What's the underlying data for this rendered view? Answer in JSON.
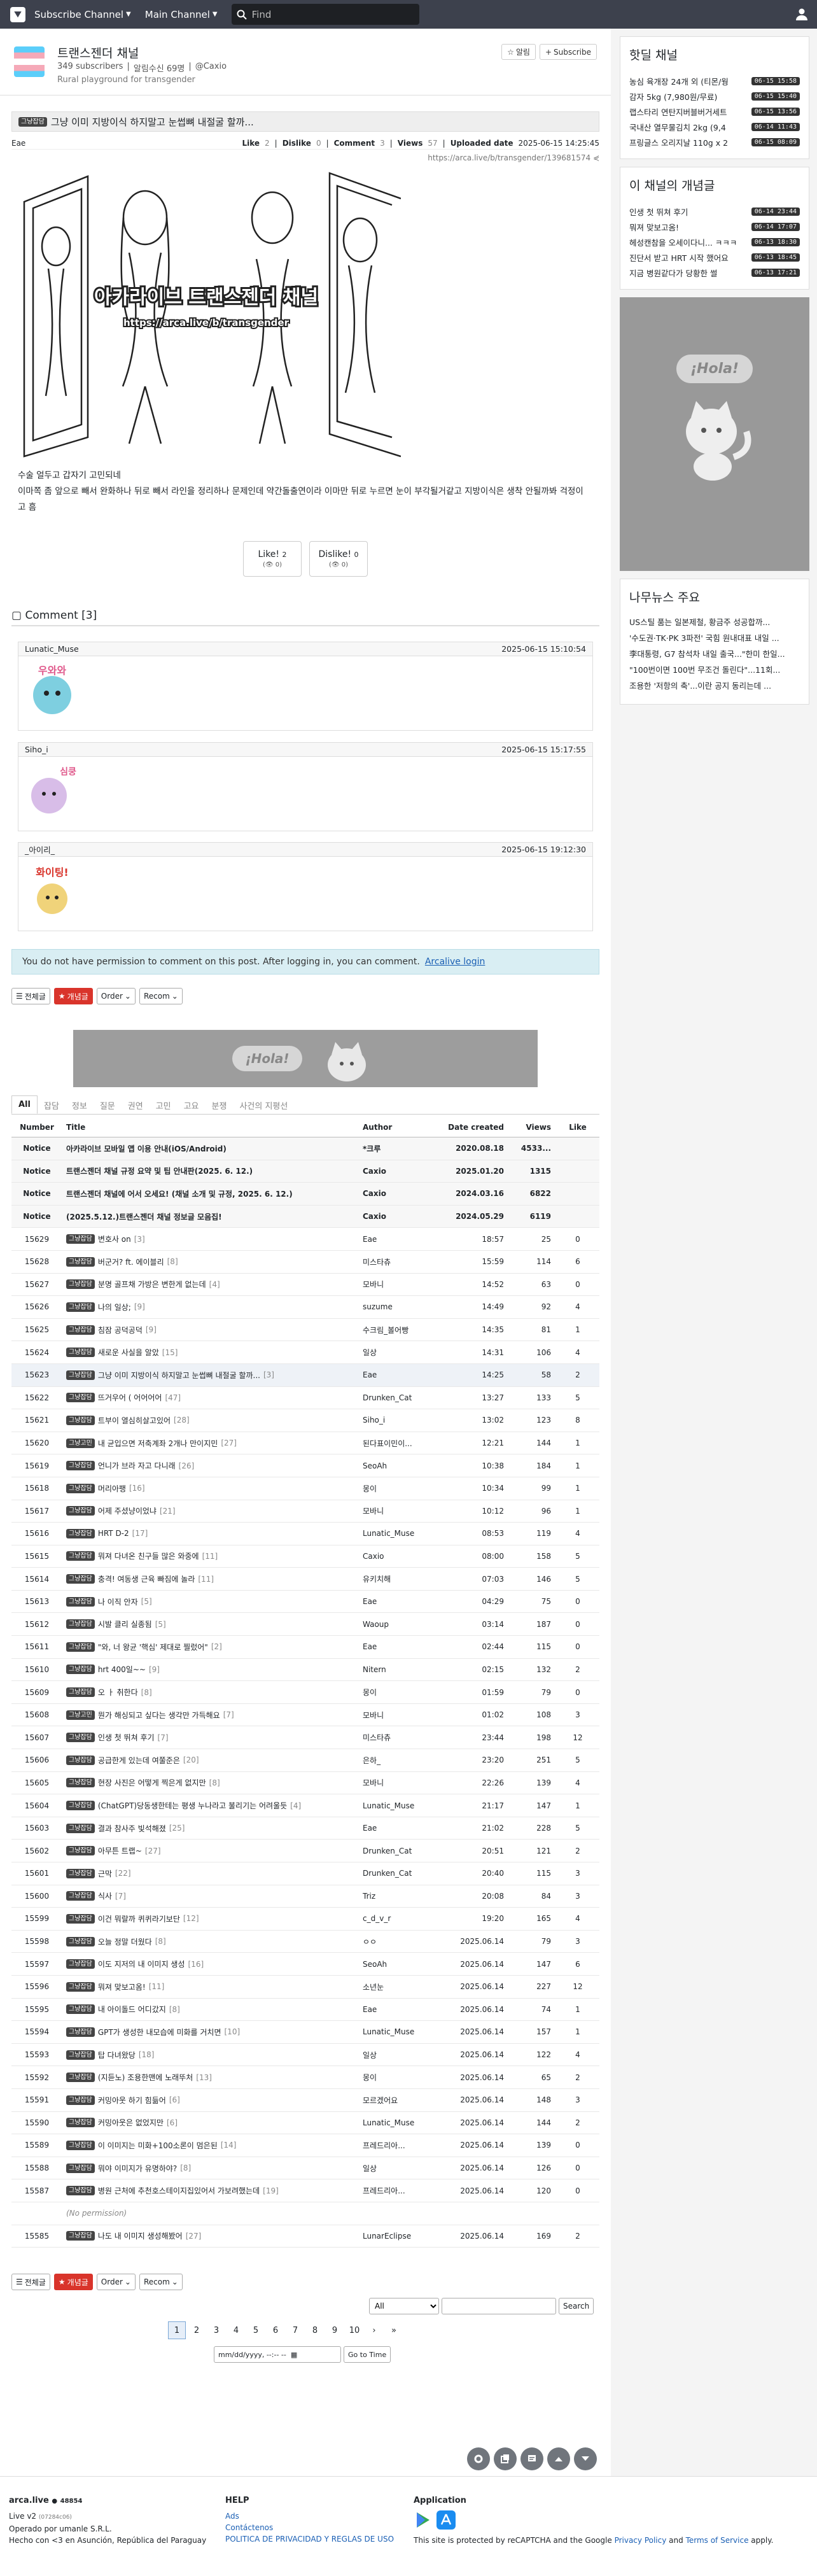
{
  "nav": {
    "subscribe_channel": "Subscribe Channel",
    "main_channel": "Main Channel",
    "search_placeholder": "Find"
  },
  "channel": {
    "title": "트랜스젠더 채널",
    "subscribers": "349 subscribers",
    "alarm": "알림수신 69명",
    "owner": "@Caxio",
    "description": "Rural playground for transgender",
    "alarm_button": "알림",
    "subscribe_button": "Subscribe"
  },
  "article": {
    "category": "그냥잡담",
    "title": "그냥 이미 지방이식 하지말고 눈썹뼈 내절굴 할까...",
    "author": "Eae",
    "like_label": "Like",
    "like_count": "2",
    "dislike_label": "Dislike",
    "dislike_count": "0",
    "comment_label": "Comment",
    "comment_count": "3",
    "views_label": "Views",
    "views_count": "57",
    "uploaded_label": "Uploaded date",
    "uploaded_date": "2025-06-15 14:25:45",
    "url": "https://arca.live/b/transgender/139681574",
    "image_text": "아카라이브 트랜스젠더 채널",
    "image_url_text": "https://arca.live/b/transgender",
    "body_line1": "수술 얼두고 갑자기 고민되네",
    "body_line2": "이마쪽 좀 앞으로 빼서 완화하나 뒤로 빼서 라인을 정리하나 문제인데 약간돌출연이라 이마만 뒤로 누르면 눈이 부각될거같고 지방이식은 생착 안될까봐 걱정이고 흠",
    "like_button": "Like!",
    "like_btn_count": "2",
    "like_sub": "0",
    "dislike_button": "Dislike!",
    "dislike_btn_count": "0",
    "dislike_sub": "0"
  },
  "comments": {
    "header": "Comment [3]",
    "items": [
      {
        "author": "Lunatic_Muse",
        "date": "2025-06-15 15:10:54",
        "sticker": "우와와"
      },
      {
        "author": "Siho_i",
        "date": "2025-06-15 15:17:55",
        "sticker": "심쿵"
      },
      {
        "author": "_아이리_",
        "date": "2025-06-15 19:12:30",
        "sticker": "화이팅!"
      }
    ]
  },
  "permission_notice": {
    "text": "You do not have permission to comment on this post. After logging in, you can comment.",
    "link": "Arcalive login"
  },
  "toolbar": {
    "all": "전체글",
    "best": "개념글",
    "order": "Order",
    "recom": "Recom"
  },
  "ad_text": "¡Hola!",
  "tabs": [
    "All",
    "잡담",
    "정보",
    "질문",
    "권연",
    "고민",
    "고요",
    "분쟁",
    "사건의 지평선"
  ],
  "table": {
    "headers": [
      "Number",
      "Title",
      "Author",
      "Date created",
      "Views",
      "Like"
    ],
    "notices": [
      {
        "num": "Notice",
        "title": "아카라이브 모바일 앱 이용 안내(iOS/Android)",
        "author": "*크루",
        "date": "2020.08.18",
        "views": "4533...",
        "like": ""
      },
      {
        "num": "Notice",
        "title": "트랜스젠더 채널 규정 요약 및 팁 안내판(2025. 6. 12.)",
        "author": "Caxio",
        "date": "2025.01.20",
        "views": "1315",
        "like": ""
      },
      {
        "num": "Notice",
        "title": "트랜스젠더 채널에 어서 오세요! (채널 소개 및 규정, 2025. 6. 12.)",
        "author": "Caxio",
        "date": "2024.03.16",
        "views": "6822",
        "like": ""
      },
      {
        "num": "Notice",
        "title": "(2025.5.12.)트랜스젠더 채널 정보글 모음집!",
        "author": "Caxio",
        "date": "2024.05.29",
        "views": "6119",
        "like": ""
      }
    ],
    "rows": [
      {
        "num": "15629",
        "cat": "그냥잡담",
        "title": "변호사 on",
        "cmt": "[3]",
        "author": "Eae",
        "date": "18:57",
        "views": "25",
        "like": "0"
      },
      {
        "num": "15628",
        "cat": "그냥잡담",
        "title": "버군거? ft. 에이블리",
        "cmt": "[8]",
        "author": "미스타츄",
        "date": "15:59",
        "views": "114",
        "like": "6"
      },
      {
        "num": "15627",
        "cat": "그냥잡담",
        "title": "분명 골프채 가방은 변한게 없는데",
        "cmt": "[4]",
        "author": "모바니",
        "date": "14:52",
        "views": "63",
        "like": "0"
      },
      {
        "num": "15626",
        "cat": "그냥잡담",
        "title": "나의 일상;",
        "cmt": "[9]",
        "author": "suzume",
        "date": "14:49",
        "views": "92",
        "like": "4"
      },
      {
        "num": "15625",
        "cat": "그냥잡담",
        "title": "침잠 공덕공덕",
        "cmt": "[9]",
        "author": "수크림_볼어빵",
        "date": "14:35",
        "views": "81",
        "like": "1"
      },
      {
        "num": "15624",
        "cat": "그냥잡담",
        "title": "새로운 사실을 알았",
        "cmt": "[15]",
        "author": "일상",
        "date": "14:31",
        "views": "106",
        "like": "4"
      },
      {
        "num": "15623",
        "cat": "그냥잡담",
        "title": "그냥 이미 지방이식 하지말고 눈썹뼈 내절굴 할까...",
        "cmt": "[3]",
        "author": "Eae",
        "date": "14:25",
        "views": "58",
        "like": "2",
        "hl": true
      },
      {
        "num": "15622",
        "cat": "그냥잡담",
        "title": "뜨거우어 ( 어어어어",
        "cmt": "[47]",
        "author": "Drunken_Cat",
        "date": "13:27",
        "views": "133",
        "like": "5"
      },
      {
        "num": "15621",
        "cat": "그냥잡담",
        "title": "트부이 열심히살고있어",
        "cmt": "[28]",
        "author": "Siho_i",
        "date": "13:02",
        "views": "123",
        "like": "8"
      },
      {
        "num": "15620",
        "cat": "그냥고민",
        "title": "내 균입으면 저축계좌 2개나 만이지민",
        "cmt": "[27]",
        "author": "된다표이민이...",
        "date": "12:21",
        "views": "144",
        "like": "1"
      },
      {
        "num": "15619",
        "cat": "그냥잡담",
        "title": "언니가 브라 자고 다니래",
        "cmt": "[26]",
        "author": "SeoAh",
        "date": "10:38",
        "views": "184",
        "like": "1"
      },
      {
        "num": "15618",
        "cat": "그냥잡담",
        "title": "머리아팽",
        "cmt": "[16]",
        "author": "몽이",
        "date": "10:34",
        "views": "99",
        "like": "1"
      },
      {
        "num": "15617",
        "cat": "그냥잡담",
        "title": "어제 주셨냥이었냐",
        "cmt": "[21]",
        "author": "모바니",
        "date": "10:12",
        "views": "96",
        "like": "1"
      },
      {
        "num": "15616",
        "cat": "그냥잡담",
        "title": "HRT D-2",
        "cmt": "[17]",
        "author": "Lunatic_Muse",
        "date": "08:53",
        "views": "119",
        "like": "4"
      },
      {
        "num": "15615",
        "cat": "그냥잡담",
        "title": "뭐져 다녀온 친구들 많은 와중에",
        "cmt": "[11]",
        "author": "Caxio",
        "date": "08:00",
        "views": "158",
        "like": "5"
      },
      {
        "num": "15614",
        "cat": "그냥잡담",
        "title": "충격! 여동생 근육 빠짐에 놀라",
        "cmt": "[11]",
        "author": "유키치해",
        "date": "07:03",
        "views": "146",
        "like": "5"
      },
      {
        "num": "15613",
        "cat": "그냥잡담",
        "title": "나 이직 안자",
        "cmt": "[5]",
        "author": "Eae",
        "date": "04:29",
        "views": "75",
        "like": "0"
      },
      {
        "num": "15612",
        "cat": "그냥잡담",
        "title": "시발 클리 실종됨",
        "cmt": "[5]",
        "author": "Waoup",
        "date": "03:14",
        "views": "187",
        "like": "0"
      },
      {
        "num": "15611",
        "cat": "그냥잡담",
        "title": "\"와, 너 왕균 '핵심' 제대로 찔렀어\"",
        "cmt": "[2]",
        "author": "Eae",
        "date": "02:44",
        "views": "115",
        "like": "0"
      },
      {
        "num": "15610",
        "cat": "그냥잡담",
        "title": "hrt 400일~~",
        "cmt": "[9]",
        "author": "Nitern",
        "date": "02:15",
        "views": "132",
        "like": "2"
      },
      {
        "num": "15609",
        "cat": "그냥잡담",
        "title": "오 ㅏ 취한다",
        "cmt": "[8]",
        "author": "몽이",
        "date": "01:59",
        "views": "79",
        "like": "0"
      },
      {
        "num": "15608",
        "cat": "그냥고민",
        "title": "뭔가 해싱되고 싶다는 생각만 가득해요",
        "cmt": "[7]",
        "author": "모바니",
        "date": "01:02",
        "views": "108",
        "like": "3"
      },
      {
        "num": "15607",
        "cat": "그냥잡담",
        "title": "인생 첫 뛰쳐 후기",
        "cmt": "[7]",
        "author": "미스타츄",
        "date": "23:44",
        "views": "198",
        "like": "12"
      },
      {
        "num": "15606",
        "cat": "그냥잡담",
        "title": "공급한게 있는데 여쭐준은",
        "cmt": "[20]",
        "author": "은하_",
        "date": "23:20",
        "views": "251",
        "like": "5"
      },
      {
        "num": "15605",
        "cat": "그냥잡담",
        "title": "현장 사진은 어떻게 찍은게 없지만",
        "cmt": "[8]",
        "author": "모바니",
        "date": "22:26",
        "views": "139",
        "like": "4"
      },
      {
        "num": "15604",
        "cat": "그냥잡담",
        "title": "(ChatGPT)당동생한테는 평생 누나라고 불리기는 어려울듯",
        "cmt": "[4]",
        "author": "Lunatic_Muse",
        "date": "21:17",
        "views": "147",
        "like": "1"
      },
      {
        "num": "15603",
        "cat": "그냥잡담",
        "title": "결과 참사주 빛석해졌",
        "cmt": "[25]",
        "author": "Eae",
        "date": "21:02",
        "views": "228",
        "like": "5"
      },
      {
        "num": "15602",
        "cat": "그냥잡담",
        "title": "아무튼 트랩~",
        "cmt": "[27]",
        "author": "Drunken_Cat",
        "date": "20:51",
        "views": "121",
        "like": "2"
      },
      {
        "num": "15601",
        "cat": "그냥잡담",
        "title": "근막",
        "cmt": "[22]",
        "author": "Drunken_Cat",
        "date": "20:40",
        "views": "115",
        "like": "3"
      },
      {
        "num": "15600",
        "cat": "그냥잡담",
        "title": "식사",
        "cmt": "[7]",
        "author": "Triz",
        "date": "20:08",
        "views": "84",
        "like": "3"
      },
      {
        "num": "15599",
        "cat": "그냥잡담",
        "title": "이건 뭐랄까 퀴퀴라기보단",
        "cmt": "[12]",
        "author": "c_d_v_r",
        "date": "19:20",
        "views": "165",
        "like": "4"
      },
      {
        "num": "15598",
        "cat": "그냥잡담",
        "title": "오늘 정말 더웠다",
        "cmt": "[8]",
        "author": "ㅇㅇ",
        "date": "2025.06.14",
        "views": "79",
        "like": "3"
      },
      {
        "num": "15597",
        "cat": "그냥잡담",
        "title": "이도 지저의 내 이미지 생성",
        "cmt": "[16]",
        "author": "SeoAh",
        "date": "2025.06.14",
        "views": "147",
        "like": "6"
      },
      {
        "num": "15596",
        "cat": "그냥잡담",
        "title": "뭐져 맞보고옴!",
        "cmt": "[11]",
        "author": "소년눈",
        "date": "2025.06.14",
        "views": "227",
        "like": "12"
      },
      {
        "num": "15595",
        "cat": "그냥잡담",
        "title": "내 아이돌드 어디갔지",
        "cmt": "[8]",
        "author": "Eae",
        "date": "2025.06.14",
        "views": "74",
        "like": "1"
      },
      {
        "num": "15594",
        "cat": "그냥잡담",
        "title": "GPT가 생성한 내모습에 미화를 거치면",
        "cmt": "[10]",
        "author": "Lunatic_Muse",
        "date": "2025.06.14",
        "views": "157",
        "like": "1"
      },
      {
        "num": "15593",
        "cat": "그냥잡담",
        "title": "탑 다녀왔당",
        "cmt": "[18]",
        "author": "일상",
        "date": "2025.06.14",
        "views": "122",
        "like": "4"
      },
      {
        "num": "15592",
        "cat": "그냥잡담",
        "title": "(지듣노) 조용한맨에 노래뚜처",
        "cmt": "[13]",
        "author": "몽이",
        "date": "2025.06.14",
        "views": "65",
        "like": "2"
      },
      {
        "num": "15591",
        "cat": "그냥잡담",
        "title": "커밍아웃 하기 힘듦어",
        "cmt": "[6]",
        "author": "모르겠어요",
        "date": "2025.06.14",
        "views": "148",
        "like": "3"
      },
      {
        "num": "15590",
        "cat": "그냥잡담",
        "title": "커밍아웃은 없었지만",
        "cmt": "[6]",
        "author": "Lunatic_Muse",
        "date": "2025.06.14",
        "views": "144",
        "like": "2"
      },
      {
        "num": "15589",
        "cat": "그냥잡담",
        "title": "이 이미지는 미화+100소론이 멈은된",
        "cmt": "[14]",
        "author": "프레드리아...",
        "date": "2025.06.14",
        "views": "139",
        "like": "0"
      },
      {
        "num": "15588",
        "cat": "그냥잡담",
        "title": "뭐야 이미지가 유명하야?",
        "cmt": "[8]",
        "author": "일상",
        "date": "2025.06.14",
        "views": "126",
        "like": "0"
      },
      {
        "num": "15587",
        "cat": "그냥잡담",
        "title": "병원 근처에 추천호스테이지집있어서 가보려했는데",
        "cmt": "[19]",
        "author": "프레드리아...",
        "date": "2025.06.14",
        "views": "120",
        "like": "0"
      },
      {
        "num": "",
        "title": "(No permission)",
        "noperm": true
      },
      {
        "num": "15585",
        "cat": "그냥잡담",
        "title": "나도 내 이미지 생성해봤어",
        "cmt": "[27]",
        "author": "LunarEclipse",
        "date": "2025.06.14",
        "views": "169",
        "like": "2"
      }
    ]
  },
  "search": {
    "select": "All",
    "button": "Search"
  },
  "pagination": {
    "pages": [
      "1",
      "2",
      "3",
      "4",
      "5",
      "6",
      "7",
      "8",
      "9",
      "10"
    ],
    "next": "›",
    "last": "»"
  },
  "date_filter": {
    "placeholder": "mm/dd/yyyy, --:-- --",
    "button": "Go to Time"
  },
  "sidebar": {
    "hot_title": "핫딜 채널",
    "hot": [
      {
        "t": "농심 육개장 24개 외 (티몬/웡",
        "time": "06-15 15:58"
      },
      {
        "t": "감자 5kg (7,980원/무료)",
        "time": "06-15 15:40"
      },
      {
        "t": "랩스타리 연탄지버블버거세트",
        "time": "06-15 13:56"
      },
      {
        "t": "국내산 열무물김치 2kg (9,4",
        "time": "06-14 11:43"
      },
      {
        "t": "프링글스 오리지날 110g x 2",
        "time": "06-15 08:09"
      }
    ],
    "best_title": "이 채널의 개념글",
    "best": [
      {
        "t": "인생 첫 뛰쳐 후기",
        "time": "06-14 23:44"
      },
      {
        "t": "뭐져 맞보고옴!",
        "time": "06-14 17:07"
      },
      {
        "t": "헤성캔참을 오세이다니... ㅋㅋㅋ",
        "time": "06-13 18:30"
      },
      {
        "t": "진단서 받고 HRT 시작 했어요",
        "time": "06-13 18:45"
      },
      {
        "t": "지금 병원같다가 당황한 썰",
        "time": "06-13 17:21"
      }
    ],
    "ad_text": "¡Hola!",
    "news_title": "나무뉴스 주요",
    "news": [
      "US스틸 품는 일본제철, 황금주 성공합까...",
      "'수도권·TK·PK 3파전' 국힘 원내대표 내일 ...",
      "李대통령, G7 참석차 내일 출국...\"한미 한일...",
      "\"100번이면 100번 무조건 돌린다\"...11회...",
      "조용한 '저항의 축'...이란 공지 동리는데 ..."
    ]
  },
  "footer": {
    "brand": "arca.live",
    "count": "48854",
    "version": "Live v2",
    "version_sub": "(07284c06)",
    "operated": "Operado por umanle S.R.L.",
    "made": "Hecho con <3 en Asunción, República del Paraguay",
    "help_title": "HELP",
    "help": [
      "Ads",
      "Contáctenos",
      "POLITICA DE PRIVACIDAD Y REGLAS DE USO"
    ],
    "app_title": "Application",
    "recaptcha_a": "This site is protected by reCAPTCHA and the Google ",
    "privacy": "Privacy Policy",
    "and": " and ",
    "terms": "Terms of Service",
    "apply": " apply."
  }
}
